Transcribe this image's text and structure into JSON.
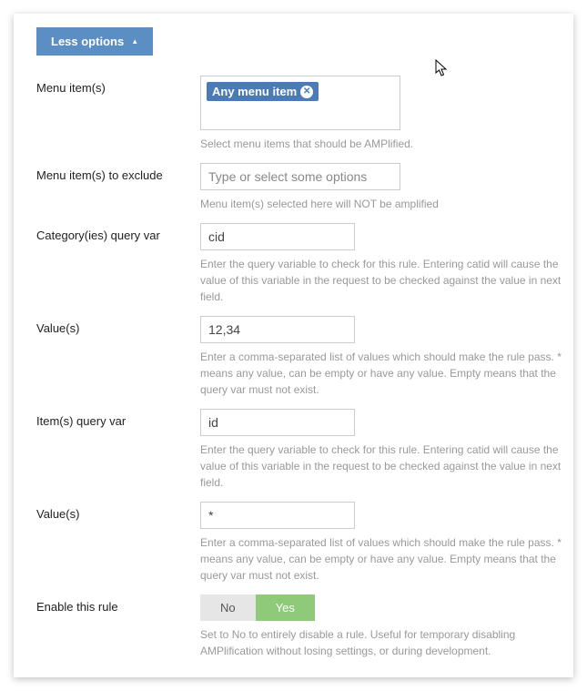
{
  "header": {
    "less_options_label": "Less options"
  },
  "fields": {
    "menu_items": {
      "label": "Menu item(s)",
      "tag": "Any menu item",
      "help": "Select menu items that should be AMPlified."
    },
    "menu_items_exclude": {
      "label": "Menu item(s) to exclude",
      "placeholder": "Type or select some options",
      "help": "Menu item(s) selected here will NOT be amplified"
    },
    "category_query_var": {
      "label": "Category(ies) query var",
      "value": "cid",
      "help": "Enter the query variable to check for this rule. Entering catid will cause the value of this variable in the request to be checked against the value in next field."
    },
    "category_values": {
      "label": "Value(s)",
      "value": "12,34",
      "help": "Enter a comma-separated list of values which should make the rule pass. * means any value, can be empty or have any value. Empty means that the query var must not exist."
    },
    "item_query_var": {
      "label": "Item(s) query var",
      "value": "id",
      "help": "Enter the query variable to check for this rule. Entering catid will cause the value of this variable in the request to be checked against the value in next field."
    },
    "item_values": {
      "label": "Value(s)",
      "value": "*",
      "help": "Enter a comma-separated list of values which should make the rule pass. * means any value, can be empty or have any value. Empty means that the query var must not exist."
    },
    "enable_rule": {
      "label": "Enable this rule",
      "no": "No",
      "yes": "Yes",
      "help": "Set to No to entirely disable a rule. Useful for temporary disabling AMPlification without losing settings, or during development."
    }
  }
}
